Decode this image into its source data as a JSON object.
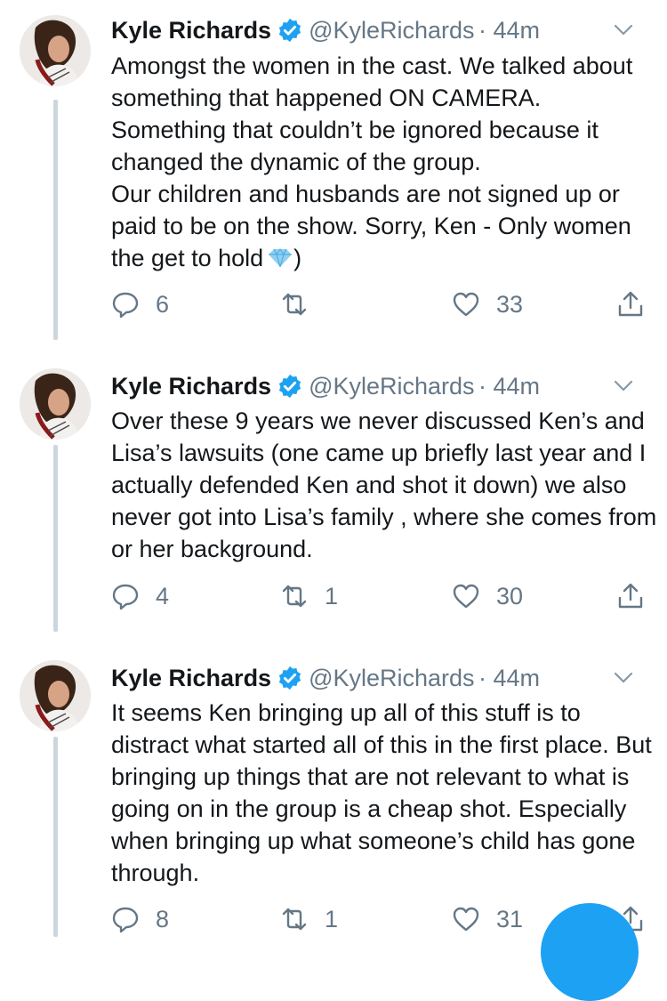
{
  "tweets": [
    {
      "display_name": "Kyle Richards",
      "handle": "@KyleRichards",
      "time": "· 44m",
      "text": "Amongst the women in the cast. We talked about something that happened ON CAMERA. Something that couldn’t be ignored because it changed the dynamic of the group.\nOur children and husbands are not signed up or paid to be on the show. Sorry, Ken - Only women the get to hold",
      "text_suffix": ")",
      "emoji": "gem-icon",
      "replies": "6",
      "retweets": "",
      "likes": "33"
    },
    {
      "display_name": "Kyle Richards",
      "handle": "@KyleRichards",
      "time": "· 44m",
      "text": "Over these 9 years we never discussed Ken’s and Lisa’s lawsuits (one came up briefly last year and I actually defended Ken and shot it down) we also never got into Lisa’s family , where she comes from or her background.",
      "replies": "4",
      "retweets": "1",
      "likes": "30"
    },
    {
      "display_name": "Kyle Richards",
      "handle": "@KyleRichards",
      "time": "· 44m",
      "text": "It seems Ken bringing up all of this stuff is to distract what started all of this in the first place. But bringing up things that are not relevant to what is going on in the group is a cheap shot. Especially when bringing up what someone’s child has gone through.",
      "replies": "8",
      "retweets": "1",
      "likes": "31"
    }
  ],
  "colors": {
    "accent": "#1da1f2",
    "text": "#14171a",
    "secondary": "#657786",
    "thread": "#ccd6dd"
  }
}
